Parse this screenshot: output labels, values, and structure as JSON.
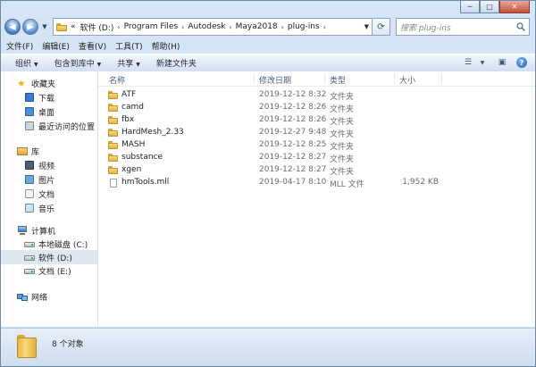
{
  "window": {
    "caption_buttons": [
      "─",
      "□",
      "✕"
    ]
  },
  "address_bar": {
    "prefix": "«",
    "crumbs": [
      "软件 (D:)",
      "Program Files",
      "Autodesk",
      "Maya2018",
      "plug-ins"
    ],
    "separator": "›"
  },
  "search": {
    "placeholder": "搜索 plug-ins"
  },
  "menu": [
    "文件(F)",
    "编辑(E)",
    "查看(V)",
    "工具(T)",
    "帮助(H)"
  ],
  "toolbar": {
    "organize": "组织",
    "include_in_library": "包含到库中",
    "share": "共享",
    "new_folder": "新建文件夹"
  },
  "nav": {
    "favorites": {
      "title": "收藏夹",
      "items": [
        "下载",
        "桌面",
        "最近访问的位置"
      ]
    },
    "library": {
      "title": "库",
      "items": [
        "视频",
        "图片",
        "文档",
        "音乐"
      ]
    },
    "computer": {
      "title": "计算机",
      "items": [
        "本地磁盘 (C:)",
        "软件 (D:)",
        "文档 (E:)"
      ],
      "selected": "软件 (D:)"
    },
    "network": {
      "title": "网络"
    }
  },
  "columns": {
    "name": "名称",
    "date": "修改日期",
    "type": "类型",
    "size": "大小"
  },
  "files": [
    {
      "name": "ATF",
      "date": "2019-12-12 8:32",
      "type": "文件夹",
      "size": "",
      "kind": "folder"
    },
    {
      "name": "camd",
      "date": "2019-12-12 8:26",
      "type": "文件夹",
      "size": "",
      "kind": "folder"
    },
    {
      "name": "fbx",
      "date": "2019-12-12 8:26",
      "type": "文件夹",
      "size": "",
      "kind": "folder"
    },
    {
      "name": "HardMesh_2.33",
      "date": "2019-12-27 9:48",
      "type": "文件夹",
      "size": "",
      "kind": "folder"
    },
    {
      "name": "MASH",
      "date": "2019-12-12 8:25",
      "type": "文件夹",
      "size": "",
      "kind": "folder"
    },
    {
      "name": "substance",
      "date": "2019-12-12 8:27",
      "type": "文件夹",
      "size": "",
      "kind": "folder"
    },
    {
      "name": "xgen",
      "date": "2019-12-12 8:27",
      "type": "文件夹",
      "size": "",
      "kind": "folder"
    },
    {
      "name": "hmTools.mll",
      "date": "2019-04-17 8:10",
      "type": "MLL 文件",
      "size": "1,952 KB",
      "kind": "file"
    }
  ],
  "status": {
    "count_text": "8 个对象"
  },
  "colors": {
    "folder": "#f0c95a",
    "selection": "#dfe7f1",
    "chrome": "#c9dcf0"
  }
}
